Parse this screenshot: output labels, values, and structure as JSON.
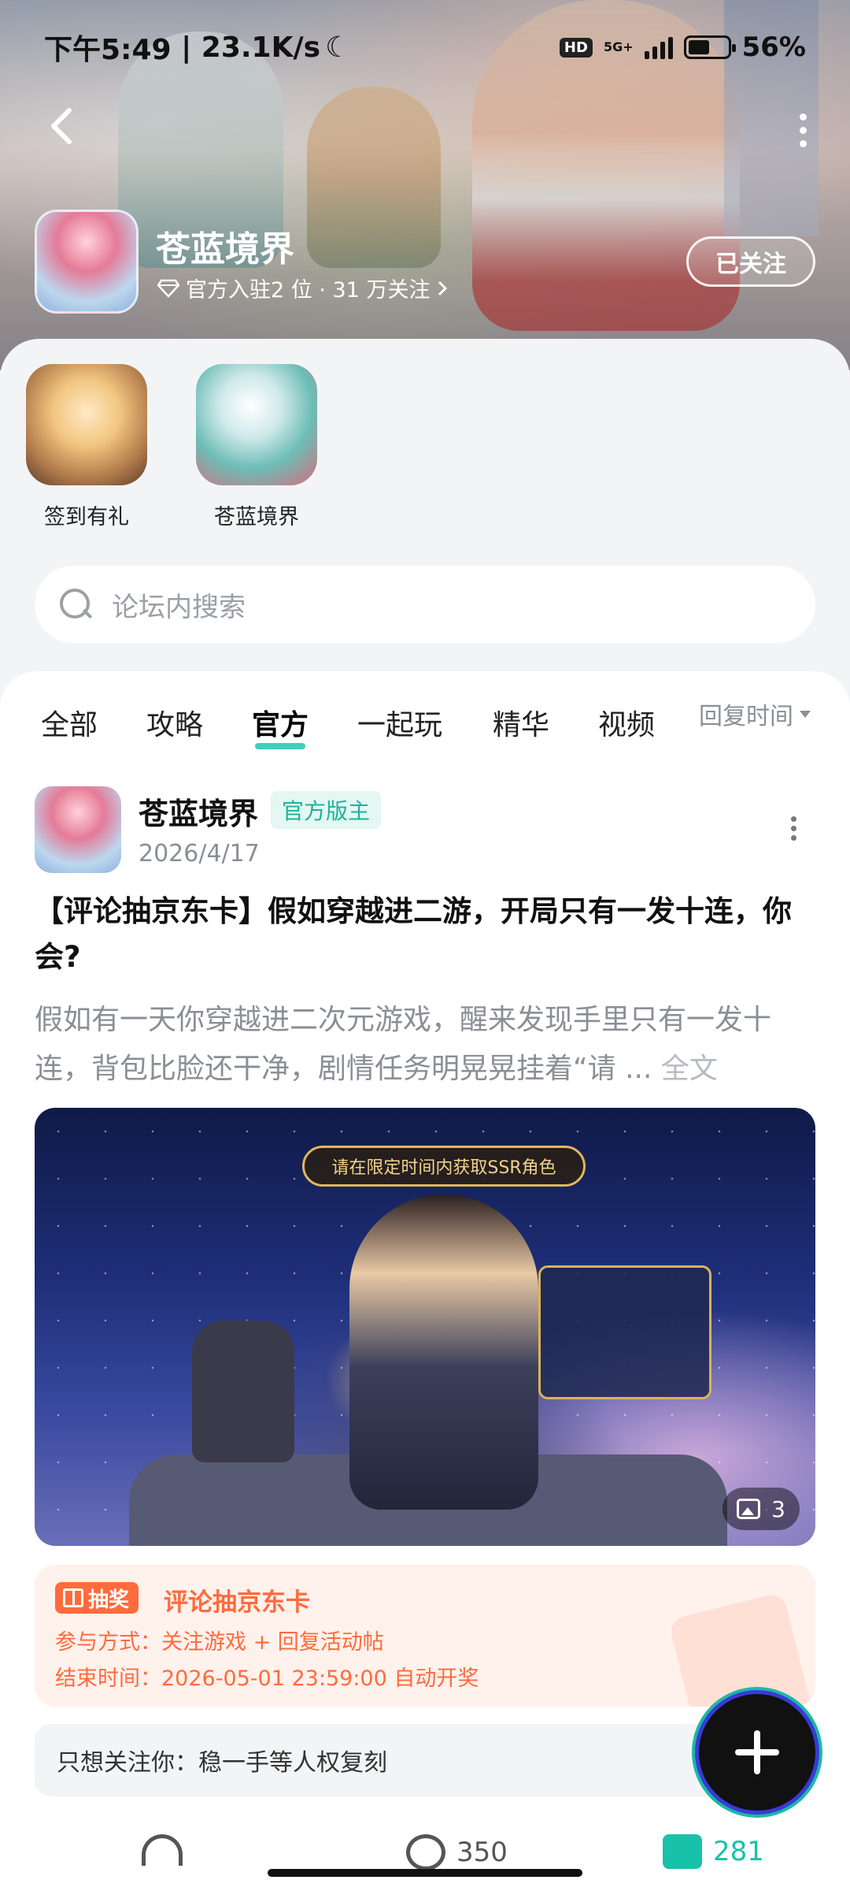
{
  "status_bar": {
    "time": "下午5:49",
    "net_speed": "23.1K/s",
    "hd": "HD",
    "network": "5G+",
    "battery": "56%"
  },
  "header": {
    "app_name": "苍蓝境界",
    "meta": "官方入驻2 位 · 31 万关注",
    "follow_label": "已关注"
  },
  "quick_links": [
    {
      "label": "签到有礼"
    },
    {
      "label": "苍蓝境界"
    }
  ],
  "search": {
    "placeholder": "论坛内搜索"
  },
  "tabs": [
    "全部",
    "攻略",
    "官方",
    "一起玩",
    "精华",
    "视频"
  ],
  "active_tab": "官方",
  "sort_label": "回复时间",
  "post": {
    "author": "苍蓝境界",
    "badge": "官方版主",
    "date": "2026/4/17",
    "title": "【评论抽京东卡】假如穿越进二游，开局只有一发十连，你会?",
    "excerpt": "假如有一天你穿越进二次元游戏，醒来发现手里只有一发十连，背包比脸还干净，剧情任务明晃晃挂着“请 ...",
    "full_text": "全文",
    "image_banner": "请在限定时间内获取SSR角色",
    "image_count": "3"
  },
  "lottery": {
    "tag": "抽奖",
    "title": "评论抽京东卡",
    "method": "参与方式：关注游戏 + 回复活动帖",
    "end_time": "结束时间：2026-05-01 23:59:00 自动开奖"
  },
  "top_comment": "只想关注你：稳一手等人权复刻",
  "actions": {
    "comments": "350",
    "likes": "281"
  }
}
